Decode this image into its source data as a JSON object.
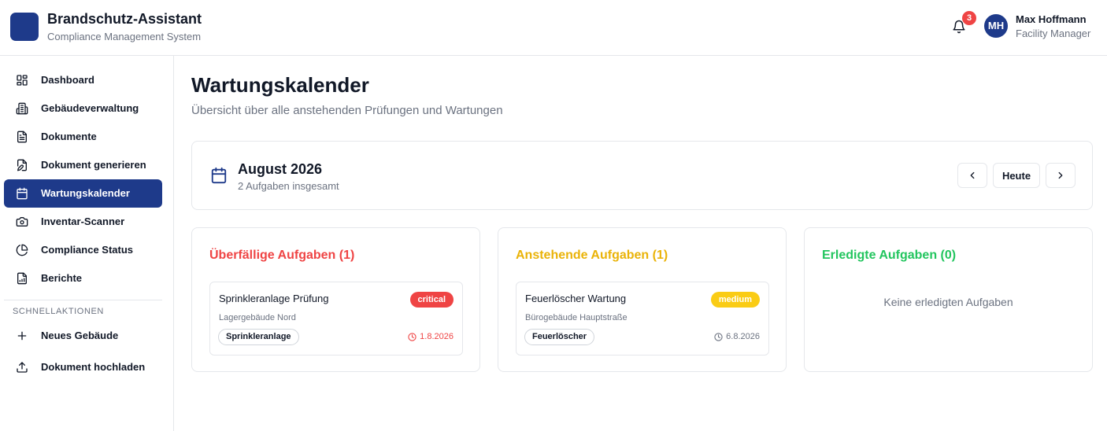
{
  "app": {
    "title": "Brandschutz-Assistant",
    "subtitle": "Compliance Management System"
  },
  "header": {
    "notification_count": "3",
    "user": {
      "initials": "MH",
      "name": "Max Hoffmann",
      "role": "Facility Manager"
    }
  },
  "sidebar": {
    "items": [
      {
        "label": "Dashboard",
        "icon": "grid-icon",
        "active": false
      },
      {
        "label": "Gebäudeverwaltung",
        "icon": "building-icon",
        "active": false
      },
      {
        "label": "Dokumente",
        "icon": "document-icon",
        "active": false
      },
      {
        "label": "Dokument generieren",
        "icon": "document-edit-icon",
        "active": false
      },
      {
        "label": "Wartungskalender",
        "icon": "calendar-icon",
        "active": true
      },
      {
        "label": "Inventar-Scanner",
        "icon": "camera-icon",
        "active": false
      },
      {
        "label": "Compliance Status",
        "icon": "pie-chart-icon",
        "active": false
      },
      {
        "label": "Berichte",
        "icon": "report-icon",
        "active": false
      }
    ],
    "quick_actions_label": "SCHNELLAKTIONEN",
    "quick_actions": [
      {
        "label": "Neues Gebäude",
        "icon": "plus-icon"
      },
      {
        "label": "Dokument hochladen",
        "icon": "upload-icon"
      }
    ]
  },
  "main": {
    "title": "Wartungskalender",
    "subtitle": "Übersicht über alle anstehenden Prüfungen und Wartungen",
    "calendar": {
      "month": "August 2026",
      "task_count": "2 Aufgaben insgesamt",
      "today_label": "Heute"
    },
    "columns": {
      "overdue": {
        "title": "Überfällige Aufgaben (1)",
        "color": "#ef4444",
        "task": {
          "title": "Sprinkleranlage Prüfung",
          "priority": "critical",
          "building": "Lagergebäude Nord",
          "tag": "Sprinkleranlage",
          "date": "1.8.2026"
        }
      },
      "upcoming": {
        "title": "Anstehende Aufgaben (1)",
        "color": "#eab308",
        "task": {
          "title": "Feuerlöscher Wartung",
          "priority": "medium",
          "building": "Bürogebäude Hauptstraße",
          "tag": "Feuerlöscher",
          "date": "6.8.2026"
        }
      },
      "done": {
        "title": "Erledigte Aufgaben (0)",
        "color": "#22c55e",
        "empty_text": "Keine erledigten Aufgaben"
      }
    }
  },
  "colors": {
    "primary": "#1e3a8a",
    "danger": "#ef4444",
    "warning": "#facc15",
    "success": "#22c55e"
  }
}
